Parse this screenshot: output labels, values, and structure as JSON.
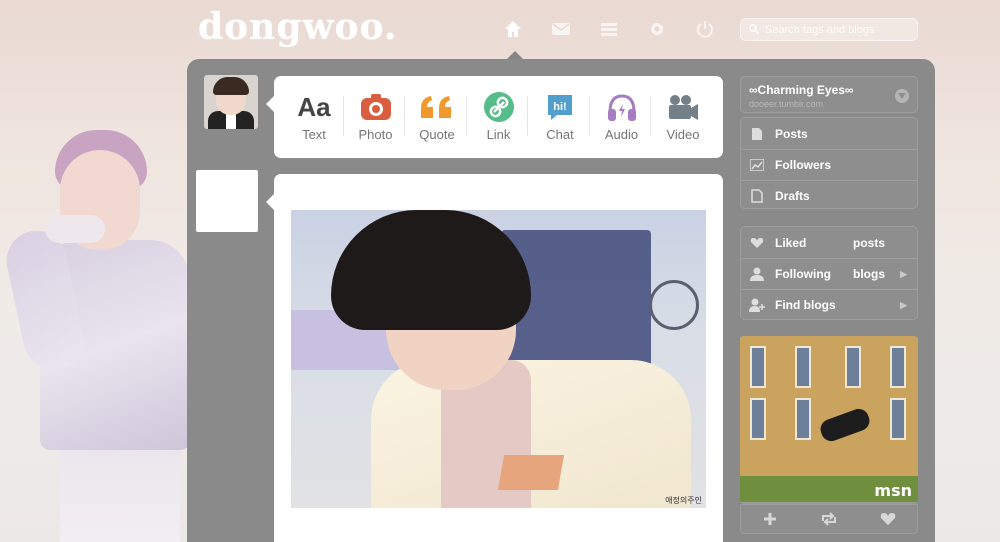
{
  "header": {
    "logo_text": "dongwoo.",
    "nav_icons": [
      "home-icon",
      "mail-icon",
      "list-icon",
      "gear-icon",
      "power-icon"
    ],
    "search_placeholder": "Search tags and blogs"
  },
  "post_types": [
    {
      "label": "Text",
      "icon": "text-icon",
      "color": "#444444"
    },
    {
      "label": "Photo",
      "icon": "camera-icon",
      "color": "#d95e40"
    },
    {
      "label": "Quote",
      "icon": "quote-icon",
      "color": "#f2992e"
    },
    {
      "label": "Link",
      "icon": "link-icon",
      "color": "#56bc8a"
    },
    {
      "label": "Chat",
      "icon": "chat-icon",
      "color": "#529ecc"
    },
    {
      "label": "Audio",
      "icon": "headphones-icon",
      "color": "#a77dc2"
    },
    {
      "label": "Video",
      "icon": "video-camera-icon",
      "color": "#748089"
    }
  ],
  "post": {
    "watermark": "애정의주인"
  },
  "sidebar": {
    "blog_name": "∞Charming Eyes∞",
    "blog_url": "dooeer.tumblr.com",
    "account_items": [
      {
        "label": "Posts",
        "icon": "posts-icon"
      },
      {
        "label": "Followers",
        "icon": "followers-icon"
      },
      {
        "label": "Drafts",
        "icon": "drafts-icon"
      }
    ],
    "dashboard_items": [
      {
        "label": "Liked",
        "second": "posts",
        "icon": "heart-icon",
        "arrow": false
      },
      {
        "label": "Following",
        "second": "blogs",
        "icon": "person-icon",
        "arrow": true
      },
      {
        "label": "Find blogs",
        "second": "",
        "icon": "person-add-icon",
        "arrow": true
      }
    ],
    "radar": {
      "watermark": "msn"
    },
    "radar_actions": [
      "plus-icon",
      "reblog-icon",
      "heart-icon"
    ]
  },
  "colors": {
    "panel": "#8a8a8a",
    "sidebar_box": "#8e8e8e",
    "page_bg": "#efe4de"
  }
}
